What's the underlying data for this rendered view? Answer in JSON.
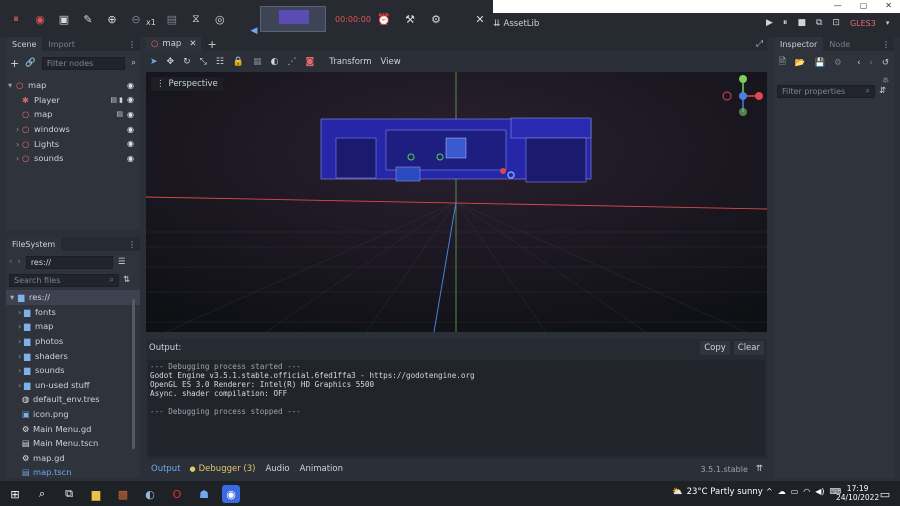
{
  "toolbar": {
    "speed_label": "x1",
    "record_time": "00:00:00",
    "assetlib_label": "AssetLib",
    "renderer_label": "GLES3"
  },
  "scene_panel": {
    "tabs": [
      "Scene",
      "Import"
    ],
    "filter_placeholder": "Filter nodes",
    "nodes": [
      {
        "label": "map",
        "level": 0,
        "icon": "node3d-icon"
      },
      {
        "label": "Player",
        "level": 1,
        "icon": "player-icon"
      },
      {
        "label": "map",
        "level": 1,
        "icon": "node3d-icon"
      },
      {
        "label": "windows",
        "level": 1,
        "icon": "node3d-icon"
      },
      {
        "label": "Lights",
        "level": 1,
        "icon": "node3d-icon"
      },
      {
        "label": "sounds",
        "level": 1,
        "icon": "node3d-icon"
      }
    ]
  },
  "filesystem_panel": {
    "title": "FileSystem",
    "path": "res://",
    "search_placeholder": "Search files",
    "items": [
      {
        "label": "res://",
        "type": "folder-root"
      },
      {
        "label": "fonts",
        "type": "folder"
      },
      {
        "label": "map",
        "type": "folder"
      },
      {
        "label": "photos",
        "type": "folder"
      },
      {
        "label": "shaders",
        "type": "folder"
      },
      {
        "label": "sounds",
        "type": "folder"
      },
      {
        "label": "un-used stuff",
        "type": "folder"
      },
      {
        "label": "default_env.tres",
        "type": "file"
      },
      {
        "label": "icon.png",
        "type": "file"
      },
      {
        "label": "Main Menu.gd",
        "type": "file"
      },
      {
        "label": "Main Menu.tscn",
        "type": "file"
      },
      {
        "label": "map.gd",
        "type": "file"
      },
      {
        "label": "map.tscn",
        "type": "file"
      }
    ]
  },
  "editor": {
    "scene_tab": "map",
    "transform_menu": "Transform",
    "view_menu": "View",
    "perspective_label": "Perspective"
  },
  "inspector": {
    "tabs": [
      "Inspector",
      "Node"
    ],
    "filter_placeholder": "Filter properties"
  },
  "output": {
    "title": "Output:",
    "copy_label": "Copy",
    "clear_label": "Clear",
    "lines": [
      "--- Debugging process started ---",
      "Godot Engine v3.5.1.stable.official.6fed1ffa3 - https://godotengine.org",
      "OpenGL ES 3.0 Renderer: Intel(R) HD Graphics 5500",
      "Async. shader compilation: OFF",
      "",
      "--- Debugging process stopped ---"
    ]
  },
  "bottom_panel": {
    "tabs": [
      "Output",
      "Debugger (3)",
      "Audio",
      "Animation"
    ],
    "version": "3.5.1.stable"
  },
  "taskbar": {
    "weather": "23°C  Partly sunny",
    "time": "17:19",
    "date": "24/10/2022"
  },
  "colors": {
    "accent": "#6fa9f0",
    "debugger_warn": "#e7c76a",
    "axis_red": "#e04848",
    "axis_green": "#7ccf5a",
    "axis_blue": "#4b7fe0"
  }
}
